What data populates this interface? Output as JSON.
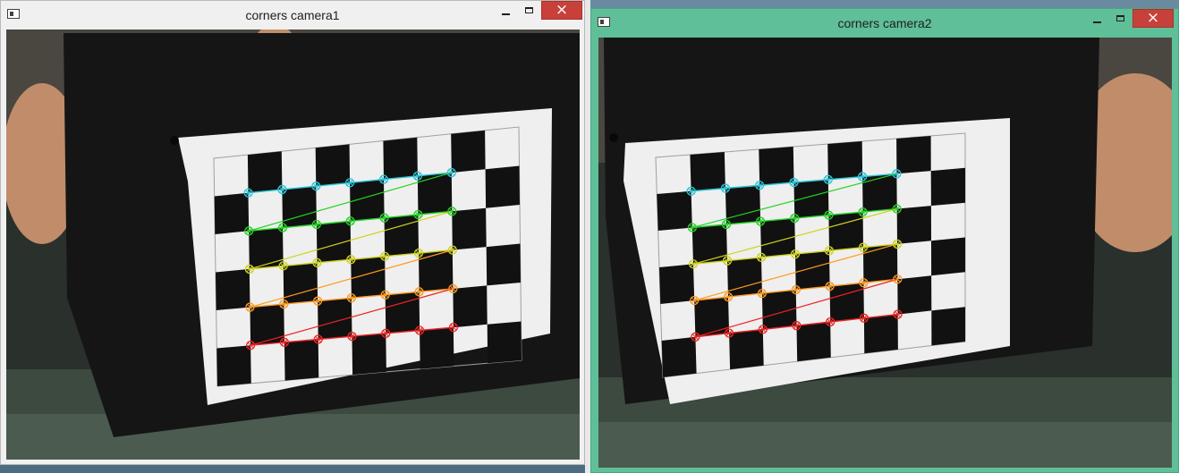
{
  "windows": [
    {
      "title": "corners camera1",
      "icon": "app-window-icon",
      "controls": {
        "minimize": "minimize-icon",
        "maximize": "maximize-icon",
        "close": "×"
      }
    },
    {
      "title": "corners camera2",
      "icon": "app-window-icon",
      "controls": {
        "minimize": "minimize-icon",
        "maximize": "maximize-icon",
        "close": "×"
      }
    }
  ],
  "calibration": {
    "grid_rows": 5,
    "grid_cols": 7,
    "row_colors": [
      "#26c6da",
      "#22d322",
      "#cfd21e",
      "#ff9a1e",
      "#ee2222"
    ]
  }
}
